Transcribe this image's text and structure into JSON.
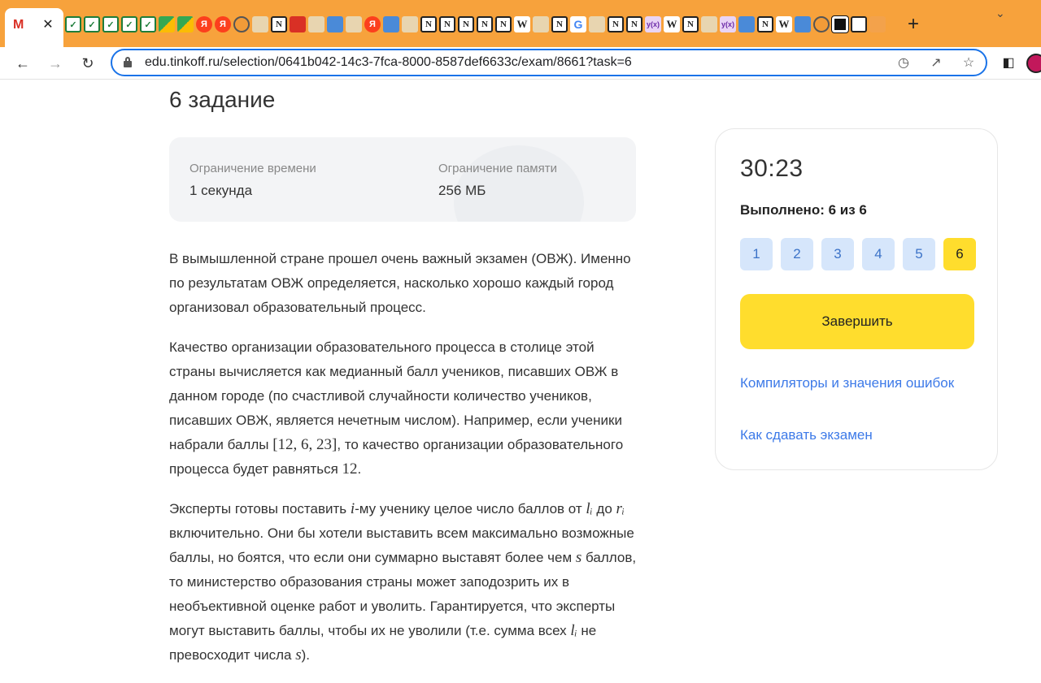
{
  "browser": {
    "active_tab_close": "✕",
    "new_tab": "+",
    "url": "edu.tinkoff.ru/selection/0641b042-14c3-7fca-8000-8587def6633c/exam/8661?task=6",
    "tab_icons": [
      "chk",
      "chk",
      "chk",
      "chk",
      "chk",
      "tri",
      "tri",
      "ya",
      "ya",
      "glob",
      "av",
      "n",
      "red",
      "av",
      "pic",
      "av",
      "ya",
      "pic",
      "av",
      "n",
      "n",
      "n",
      "n",
      "n",
      "w",
      "av",
      "n",
      "gg",
      "av",
      "n",
      "n",
      "yx",
      "w",
      "n",
      "av",
      "yx",
      "pic",
      "n",
      "w",
      "pic",
      "glob",
      "blk",
      "sq",
      "so"
    ]
  },
  "task": {
    "title": "6 задание",
    "time_limit_label": "Ограничение времени",
    "time_limit_value": "1 секунда",
    "memory_limit_label": "Ограничение памяти",
    "memory_limit_value": "256 МБ",
    "p1": "В вымышленной стране прошел очень важный экзамен (ОВЖ). Именно по результатам ОВЖ определяется, насколько хорошо каждый город организовал образовательный процесс.",
    "p2_a": "Качество организации образовательного процесса в столице этой страны вычисляется как медианный балл учеников, писавших ОВЖ в данном городе (по счастливой случайности количество учеников, писавших ОВЖ, является нечетным числом). Например, если ученики набрали баллы ",
    "p2_math1": "[12, 6, 23]",
    "p2_b": ", то качество организации образовательного процесса будет равняться ",
    "p2_math2": "12",
    "p2_c": ".",
    "p3_a": "Эксперты готовы поставить ",
    "p3_i": "i",
    "p3_b": "-му ученику целое число баллов от ",
    "p3_l": "lᵢ",
    "p3_c": " до ",
    "p3_r": "rᵢ",
    "p3_d": " включительно. Они бы хотели выставить всем максимально возможные баллы, но боятся, что если они суммарно выставят более чем ",
    "p3_s": "s",
    "p3_e": " баллов, то министерство образования страны может заподозрить их в необъективной оценке работ и уволить. Гарантируется, что эксперты могут выставить баллы, чтобы их не уволили (т.е. сумма всех ",
    "p3_l2": "lᵢ",
    "p3_f": " не превосходит числа ",
    "p3_s2": "s",
    "p3_g": ")."
  },
  "sidebar": {
    "timer": "30:23",
    "progress": "Выполнено: 6 из 6",
    "tasks": [
      "1",
      "2",
      "3",
      "4",
      "5",
      "6"
    ],
    "active_task": "6",
    "finish_label": "Завершить",
    "link_compilers": "Компиляторы и значения ошибок",
    "link_howto": "Как сдавать экзамен"
  },
  "colors": {
    "tabstrip": "#f7a23c",
    "accent_yellow": "#ffdd2d",
    "task_chip": "#d6e6fb",
    "link": "#3d7ae8"
  }
}
